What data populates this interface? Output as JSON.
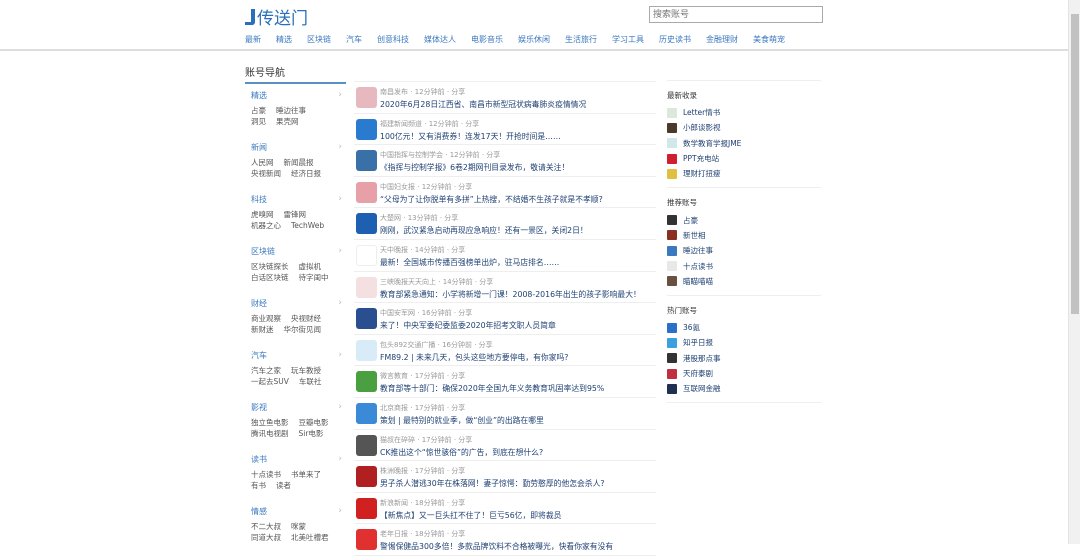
{
  "header": {
    "logo": "传送门",
    "search_placeholder": "搜索账号",
    "nav": [
      "最新",
      "精选",
      "区块链",
      "汽车",
      "创意科技",
      "媒体达人",
      "电影音乐",
      "娱乐休闲",
      "生活旅行",
      "学习工具",
      "历史读书",
      "金融理财",
      "美食萌宠"
    ]
  },
  "sidebar": {
    "title": "账号导航",
    "categories": [
      {
        "title": "精选",
        "links": [
          [
            "占豪",
            "睡边往事"
          ],
          [
            "洞见",
            "果壳网"
          ]
        ]
      },
      {
        "title": "新闻",
        "links": [
          [
            "人民网",
            "新闻晨报"
          ],
          [
            "央视新闻",
            "经济日报"
          ]
        ]
      },
      {
        "title": "科技",
        "links": [
          [
            "虎嗅网",
            "雷锋网"
          ],
          [
            "机器之心",
            "TechWeb"
          ]
        ]
      },
      {
        "title": "区块链",
        "links": [
          [
            "区块链探长",
            "虚拟机"
          ],
          [
            "白话区块链",
            "待字闺中"
          ]
        ]
      },
      {
        "title": "财经",
        "links": [
          [
            "商业观察",
            "央视财经"
          ],
          [
            "新财迷",
            "华尔街见闻"
          ]
        ]
      },
      {
        "title": "汽车",
        "links": [
          [
            "汽车之家",
            "玩车教授"
          ],
          [
            "一起去SUV",
            "车联社"
          ]
        ]
      },
      {
        "title": "影视",
        "links": [
          [
            "独立鱼电影",
            "豆瓣电影"
          ],
          [
            "腾讯电视剧",
            "Sir电影"
          ]
        ]
      },
      {
        "title": "读书",
        "links": [
          [
            "十点读书",
            "书单来了"
          ],
          [
            "有书",
            "读者"
          ]
        ]
      },
      {
        "title": "情感",
        "links": [
          [
            "不二大叔",
            "咪蒙"
          ],
          [
            "同道大叔",
            "北美吐槽君"
          ]
        ]
      }
    ]
  },
  "feed": [
    {
      "source": "南昌发布",
      "time": "12分钟前",
      "share": "分享",
      "title": "2020年6月28日江西省、南昌市新型冠状病毒肺炎疫情情况",
      "color": "#e8b8c0"
    },
    {
      "source": "福建新闻频道",
      "time": "12分钟前",
      "share": "分享",
      "title": "100亿元！又有消费券！连发17天！开抢时间是……",
      "color": "#2a7ad0"
    },
    {
      "source": "中国指挥与控制学会",
      "time": "12分钟前",
      "share": "分享",
      "title": "《指挥与控制学报》6卷2期网刊目录发布，敬请关注！",
      "color": "#3a70a8"
    },
    {
      "source": "中国妇女报",
      "time": "12分钟前",
      "share": "分享",
      "title": "“父母为了让你脱单有多拼”上热搜，不结婚不生孩子就是不孝顺?",
      "color": "#e8a0a8"
    },
    {
      "source": "大楚网",
      "time": "13分钟前",
      "share": "分享",
      "title": "刚刚，武汉紧急启动再现应急响应！还有一景区，关闭2日！",
      "color": "#1d5fb0"
    },
    {
      "source": "天中晚报",
      "time": "14分钟前",
      "share": "分享",
      "title": "最新！全国城市传播百强榜单出炉，驻马店排名……",
      "color": "#fff"
    },
    {
      "source": "三峡晚报天天向上",
      "time": "14分钟前",
      "share": "分享",
      "title": "教育部紧急通知：小学将新增一门课！2008-2016年出生的孩子影响最大！",
      "color": "#f4e0e0"
    },
    {
      "source": "中国安军网",
      "time": "16分钟前",
      "share": "分享",
      "title": "来了！中央军委纪委监委2020年招考文职人员简章",
      "color": "#2a4f90"
    },
    {
      "source": "包头892交通广播",
      "time": "16分钟前",
      "share": "分享",
      "title": "FM89.2 | 未来几天，包头这些地方要停电，有你家吗?",
      "color": "#d8ecf8"
    },
    {
      "source": "微言教育",
      "time": "17分钟前",
      "share": "分享",
      "title": "教育部等十部门：确保2020年全国九年义务教育巩固率达到95%",
      "color": "#4aa040"
    },
    {
      "source": "北京商报",
      "time": "17分钟前",
      "share": "分享",
      "title": "策划 | 最特别的就业季，做“创业”的出路在哪里",
      "color": "#3a8ad8"
    },
    {
      "source": "猫叔在碎碎",
      "time": "17分钟前",
      "share": "分享",
      "title": "CK推出这个“惊世骇俗”的广告，到底在想什么?",
      "color": "#555"
    },
    {
      "source": "株洲晚报",
      "time": "17分钟前",
      "share": "分享",
      "title": "男子杀人潜逃30年在株落网！妻子惊愕：勤劳憨厚的他怎会杀人?",
      "color": "#b02020"
    },
    {
      "source": "新浪新闻",
      "time": "18分钟前",
      "share": "分享",
      "title": "【新焦点】又一巨头扛不住了！巨亏56亿，即将裁员",
      "color": "#d02020"
    },
    {
      "source": "老年日报",
      "time": "18分钟前",
      "share": "分享",
      "title": "警惕保健品300多倍！多款品牌饮料不合格被曝光，快看你家有没有",
      "color": "#e03030"
    }
  ],
  "right": {
    "sections": [
      {
        "title": "最新收录",
        "items": [
          [
            "Letter情书",
            "#dde8dd"
          ],
          [
            "小郎谈影视",
            "#4a3a2a"
          ],
          [
            "数学教育学报JME",
            "#cfe8e8"
          ],
          [
            "PPT充电站",
            "#d02030"
          ],
          [
            "理财打扭瘦",
            "#e0c040"
          ]
        ]
      },
      {
        "title": "推荐账号",
        "items": [
          [
            "占豪",
            "#333"
          ],
          [
            "新世相",
            "#8a3020"
          ],
          [
            "睡边往事",
            "#3a78c0"
          ],
          [
            "十点读书",
            "#e8e8e8"
          ],
          [
            "瞄瞄喵喵",
            "#6a5040"
          ]
        ]
      },
      {
        "title": "热门账号",
        "items": [
          [
            "36氪",
            "#2a70c8"
          ],
          [
            "知乎日报",
            "#3aa0e0"
          ],
          [
            "港股那点事",
            "#333"
          ],
          [
            "天府泰剧",
            "#c03040"
          ],
          [
            "互联网金融",
            "#203050"
          ]
        ]
      }
    ]
  }
}
